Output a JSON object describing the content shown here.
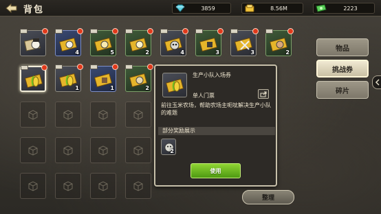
{
  "header": {
    "title": "背包",
    "back_icon": "back-arrow-icon"
  },
  "currencies": {
    "gem": {
      "icon": "gem-icon",
      "value": "3859"
    },
    "gold": {
      "icon": "gold-icon",
      "value": "8.56M"
    },
    "ticket": {
      "icon": "green-ticket-icon",
      "value": "2223"
    }
  },
  "tabs": [
    {
      "label": "物品"
    },
    {
      "label": "挑战券",
      "active": true
    },
    {
      "label": "碎片"
    }
  ],
  "inventory": {
    "row1": [
      {
        "count": ""
      },
      {
        "count": "4"
      },
      {
        "count": "5"
      },
      {
        "count": "2"
      },
      {
        "count": "4"
      },
      {
        "count": "3"
      },
      {
        "count": "3"
      },
      {
        "count": "2"
      }
    ],
    "row2": [
      {
        "count": "",
        "selected": true
      },
      {
        "count": "1"
      },
      {
        "count": "1"
      },
      {
        "count": "2"
      }
    ]
  },
  "popup": {
    "item_name": "生产小队入场券",
    "item_type": "单人门票",
    "description": "前往玉米农场，帮助农场主呃呔解决生产小队的难题",
    "rewards_header": "部分奖励展示",
    "reward_count": "2",
    "use_label": "使用"
  },
  "footer": {
    "sort_label": "整理"
  },
  "colors": {
    "accent_green": "#6cbf22",
    "notification_red": "#e03a1c"
  }
}
